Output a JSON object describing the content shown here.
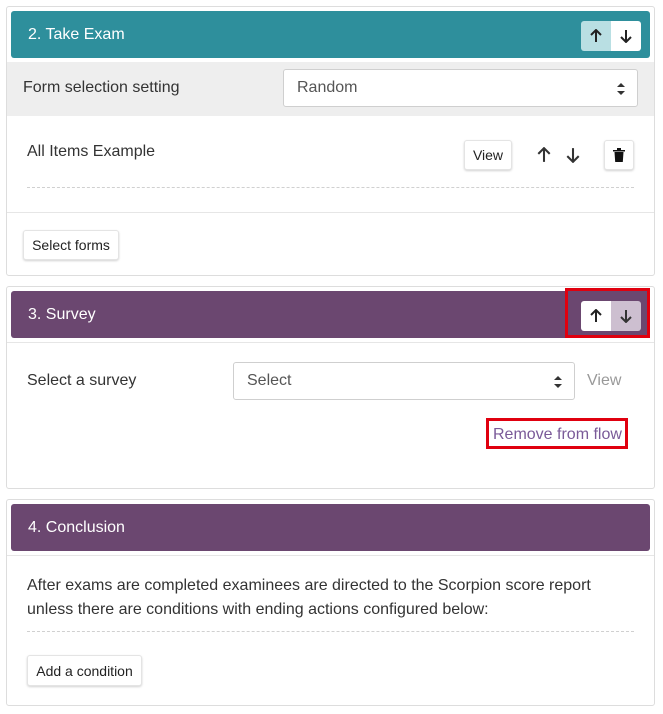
{
  "take_exam": {
    "title": "2. Take Exam",
    "form_selection_label": "Form selection setting",
    "form_selection_value": "Random",
    "item_name": "All Items Example",
    "view_label": "View",
    "select_forms_label": "Select forms"
  },
  "survey": {
    "title": "3. Survey",
    "select_label": "Select a survey",
    "select_value": "Select",
    "view_label": "View",
    "remove_label": "Remove from flow"
  },
  "conclusion": {
    "title": "4. Conclusion",
    "description": "After exams are completed examinees are directed to the Scorpion score report unless there are conditions with ending actions configured below:",
    "add_condition_label": "Add a condition"
  },
  "icons": {
    "up": "arrow-up-icon",
    "down": "arrow-down-icon",
    "delete": "trash-icon",
    "caret": "select-caret-icon"
  },
  "colors": {
    "take_exam_header": "#2e8f9c",
    "survey_header": "#6b4770",
    "conclusion_header": "#6b4770",
    "link": "#7a5a98",
    "highlight": "#e0000f"
  }
}
